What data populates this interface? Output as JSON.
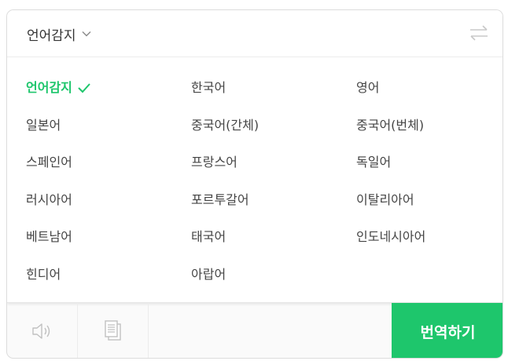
{
  "header": {
    "source_language": "언어감지",
    "dropdown_icon": "chevron-down-icon",
    "swap_icon": "swap-arrows-icon"
  },
  "languages": [
    [
      "언어감지",
      "한국어",
      "영어"
    ],
    [
      "일본어",
      "중국어(간체)",
      "중국어(번체)"
    ],
    [
      "스페인어",
      "프랑스어",
      "독일어"
    ],
    [
      "러시아어",
      "포르투갈어",
      "이탈리아어"
    ],
    [
      "베트남어",
      "태국어",
      "인도네시아어"
    ],
    [
      "힌디어",
      "아랍어"
    ]
  ],
  "selected_language": "언어감지",
  "toolbar": {
    "speaker_icon": "speaker-icon",
    "copy_icon": "copy-document-icon",
    "translate_label": "번역하기"
  },
  "colors": {
    "accent": "#1ec66c",
    "text": "#444444",
    "border": "#dcdcdc"
  }
}
